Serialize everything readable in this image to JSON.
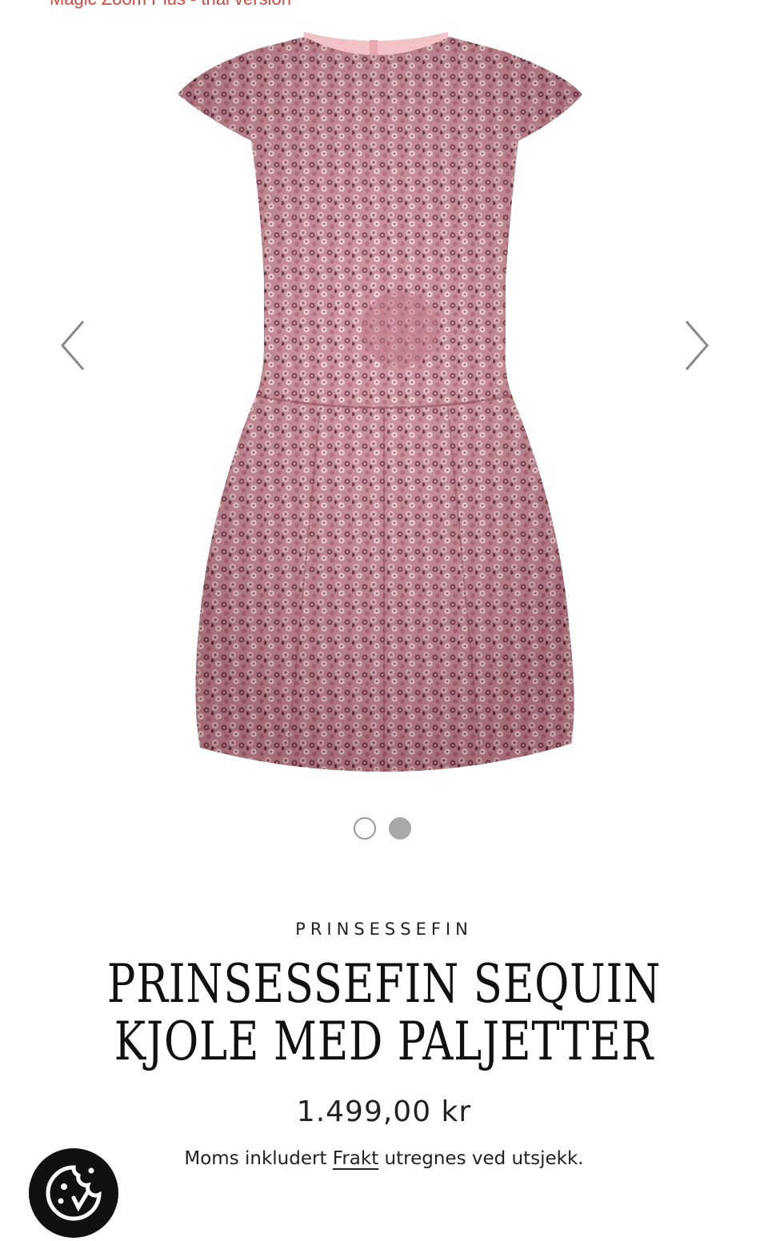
{
  "banner": {
    "text": "Magic Zoom Plus - trial version"
  },
  "gallery": {
    "image_alt": "Prinsessefin sequin kjole med paljetter",
    "dress_color": "#c98491",
    "prev_icon": "chevron-left-icon",
    "next_icon": "chevron-right-icon",
    "dots": {
      "count": 2,
      "active_index": 2
    }
  },
  "product": {
    "brand": "PRINSESSEFIN",
    "title_line1": "PRINSESSEFIN SEQUIN",
    "title_line2": "KJOLE MED PALJETTER",
    "price": "1.499,00 kr",
    "tax_prefix": "Moms inkludert ",
    "shipping_link": "Frakt",
    "tax_suffix": " utregnes ved utsjekk."
  },
  "cookie_button": {
    "icon": "cookie-icon"
  }
}
